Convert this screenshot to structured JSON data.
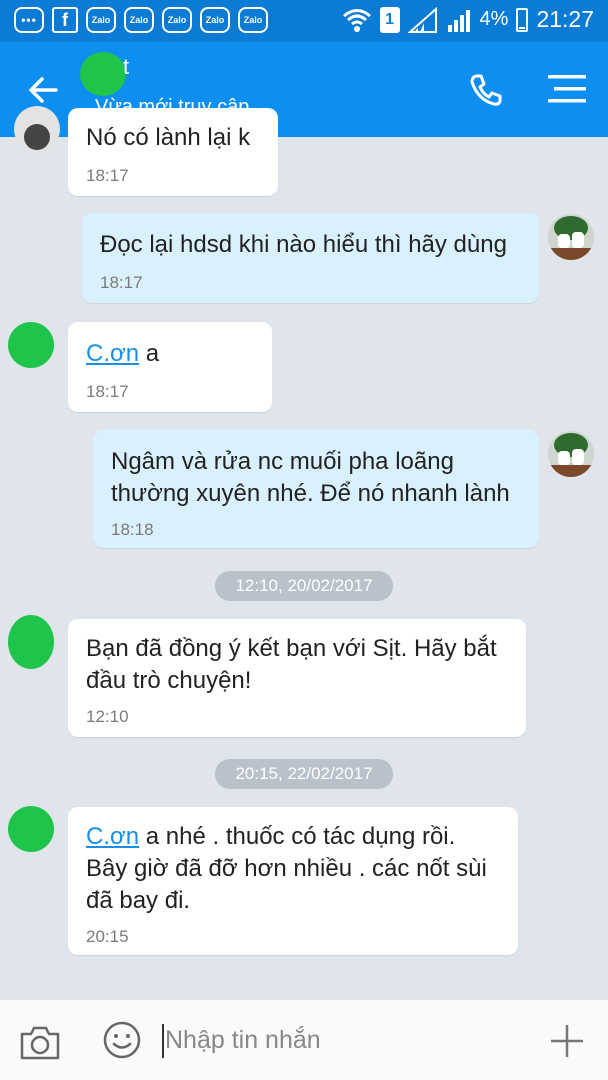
{
  "status_bar": {
    "apps": [
      "Zalo",
      "Zalo",
      "Zalo",
      "Zalo",
      "Zalo"
    ],
    "sim": "1",
    "battery": "4%",
    "time": "21:27"
  },
  "header": {
    "name_visible_suffix": "t",
    "status": "Vừa mới truy cập"
  },
  "messages": [
    {
      "dir": "in",
      "text": "Nó có lành lại k",
      "time": "18:17"
    },
    {
      "dir": "out",
      "text": "Đọc lại hdsd khi nào hiểu thì hãy dùng",
      "time": "18:17"
    },
    {
      "dir": "in",
      "link": "C.ơn",
      "text": " a",
      "time": "18:17"
    },
    {
      "dir": "out",
      "line1": "Ngâm và rửa nc muối pha loãng",
      "line2": "thường xuyên nhé. Để nó nhanh lành",
      "time": "18:18"
    },
    {
      "dir": "in",
      "line1": "Bạn đã đồng ý kết bạn với Sịt. Hãy bắt",
      "line2": "đầu trò chuyện!",
      "time": "12:10"
    },
    {
      "dir": "in",
      "link": "C.ơn",
      "line1_rest": " a nhé . thuốc có tác dụng rồi.",
      "line2": "Bây giờ đã đỡ hơn nhiều . các nốt sùi",
      "line3": "đã bay đi.",
      "time": "20:15"
    }
  ],
  "date_separators": [
    "12:10, 20/02/2017",
    "20:15, 22/02/2017"
  ],
  "input": {
    "placeholder": "Nhập tin nhắn"
  },
  "colors": {
    "status_bar": "#0b7bd3",
    "app_bar": "#0c8ff1",
    "background": "#dfe5eb",
    "outgoing": "#d9f0fd",
    "incoming": "#ffffff",
    "link": "#1a8fe3"
  }
}
